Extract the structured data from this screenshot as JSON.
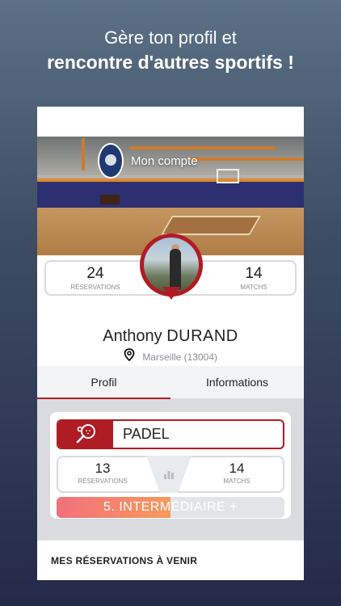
{
  "promo": {
    "line1": "Gère ton profil et",
    "line2": "rencontre d'autres sportifs !"
  },
  "header": {
    "title": "Mon compte"
  },
  "profile": {
    "reservations_count": "24",
    "reservations_label": "RÉSERVATIONS",
    "matches_count": "14",
    "matches_label": "MATCHS",
    "first_name": "Anthony",
    "last_name": "DURAND",
    "location": "Marseille (13004)"
  },
  "tabs": [
    {
      "label": "Profil",
      "active": true
    },
    {
      "label": "Informations",
      "active": false
    }
  ],
  "sport_card": {
    "sport": "PADEL",
    "icon": "padel-racket-icon",
    "reservations_count": "13",
    "reservations_label": "RÉSERVATIONS",
    "matches_count": "14",
    "matches_label": "MATCHS",
    "level_label": "5. INTERMÉDIAIRE +",
    "level_progress": 0.5
  },
  "upcoming": {
    "title": "MES RÉSERVATIONS À VENIR"
  },
  "colors": {
    "accent": "#b01c24",
    "level_gradient_start": "#f2707d",
    "level_gradient_end": "#f79a5b"
  }
}
